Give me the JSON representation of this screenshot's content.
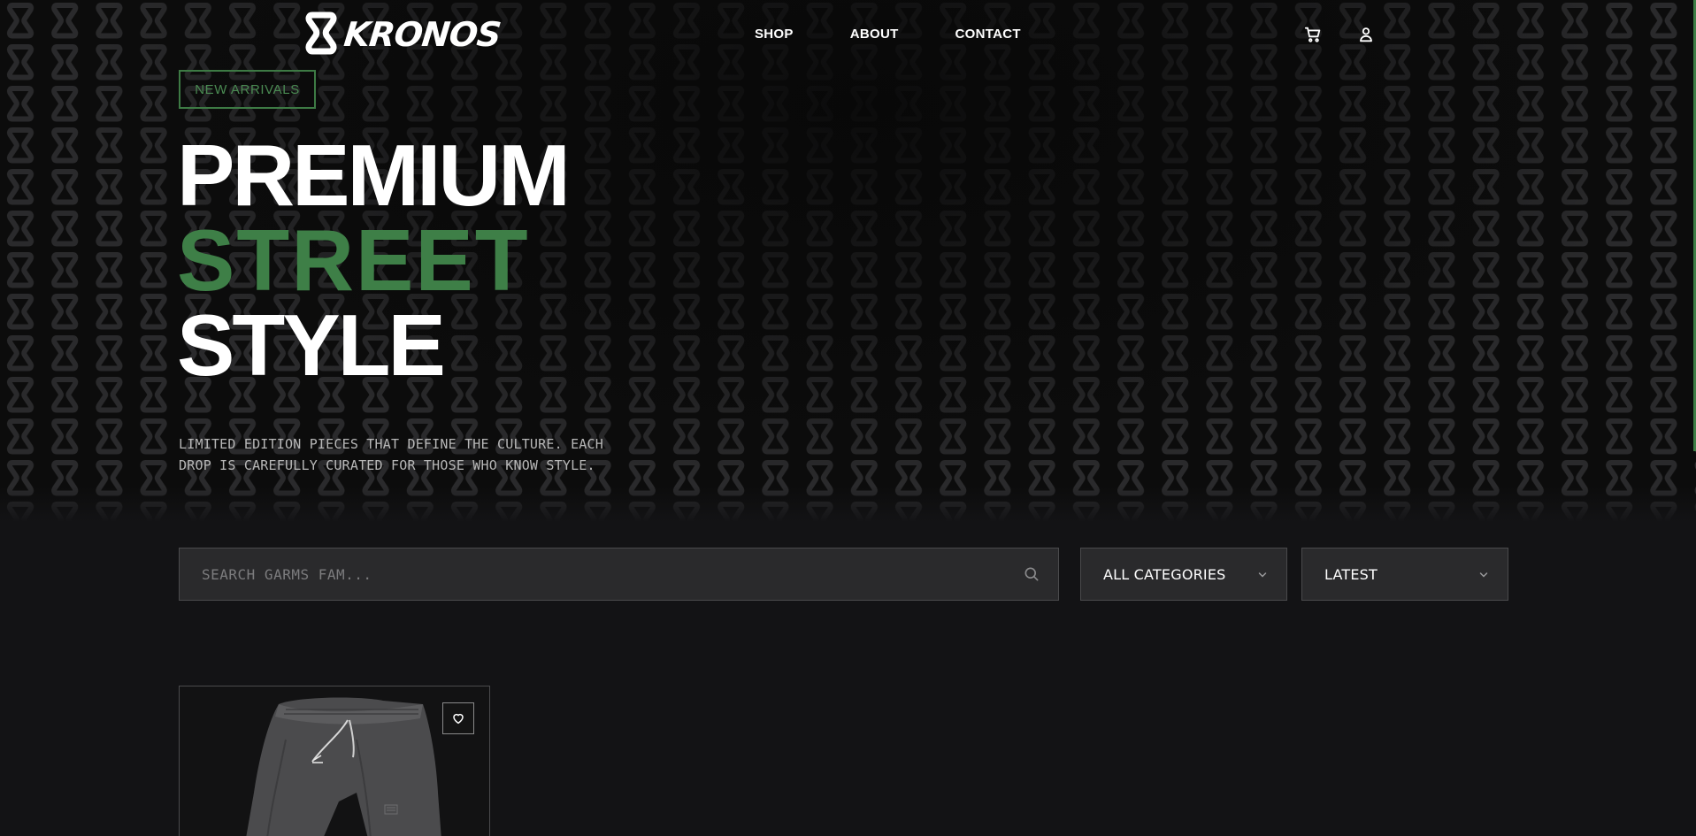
{
  "brand": {
    "logo_text": "KRONOS",
    "accent_color": "#3e7f47",
    "background_color": "#131315"
  },
  "nav": {
    "links": [
      {
        "label": "SHOP"
      },
      {
        "label": "ABOUT"
      },
      {
        "label": "CONTACT"
      }
    ],
    "icons": [
      "cart-icon",
      "user-icon"
    ]
  },
  "hero": {
    "badge": "NEW ARRIVALS",
    "headline": {
      "line1": "PREMIUM",
      "line2": "STREET",
      "line3": "STYLE"
    },
    "subtext_line1": "LIMITED EDITION PIECES THAT DEFINE THE CULTURE. EACH",
    "subtext_line2": "DROP IS CAREFULLY CURATED FOR THOSE WHO KNOW STYLE."
  },
  "filters": {
    "search_placeholder": "SEARCH GARMS FAM...",
    "search_value": "",
    "category_selected": "ALL CATEGORIES",
    "sort_selected": "LATEST"
  },
  "products": [
    {
      "image": "grey-sweatpants",
      "wishlist_icon": "heart-icon"
    }
  ]
}
